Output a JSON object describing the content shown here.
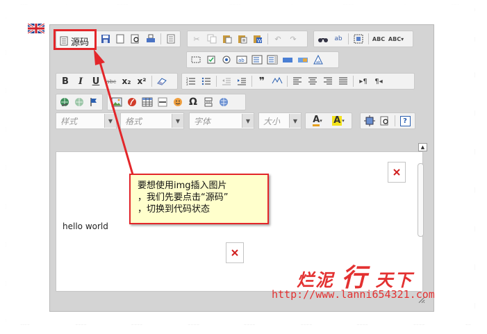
{
  "language": {
    "flag_icon": "uk-flag-icon"
  },
  "toolbar": {
    "source_label": "源码",
    "row1": [
      "save-icon",
      "new-page-icon",
      "preview-icon",
      "print-icon",
      "templates-icon",
      "cut-icon",
      "copy-icon",
      "paste-icon",
      "paste-text-icon",
      "paste-word-icon",
      "undo-icon",
      "redo-icon",
      "find-icon",
      "replace-icon",
      "select-all-icon",
      "spellcheck-icon",
      "spellcheck-as-you-type-icon"
    ],
    "row2": [
      "form-icon",
      "checkbox-icon",
      "radio-icon",
      "textfield-icon",
      "textarea-icon",
      "select-icon",
      "button-icon",
      "image-button-icon",
      "hidden-field-icon"
    ],
    "row3": [
      "bold-icon",
      "italic-icon",
      "underline-icon",
      "strike-icon",
      "subscript-icon",
      "superscript-icon",
      "remove-format-icon",
      "numbered-list-icon",
      "bulleted-list-icon",
      "outdent-icon",
      "indent-icon",
      "blockquote-icon",
      "div-icon",
      "align-left-icon",
      "align-center-icon",
      "align-right-icon",
      "justify-icon",
      "ltr-icon",
      "rtl-icon"
    ],
    "row4": [
      "link-icon",
      "unlink-icon",
      "anchor-icon",
      "image-icon",
      "flash-icon",
      "table-icon",
      "horizontal-rule-icon",
      "smiley-icon",
      "special-char-icon",
      "page-break-icon",
      "iframe-icon"
    ],
    "bold": "B",
    "italic": "I",
    "underline": "U",
    "strike": "abc",
    "subscript": "x₂",
    "superscript": "x²",
    "spell1": "ABC",
    "spell2": "ABC",
    "omega": "Ω",
    "styles_label": "样式",
    "format_label": "格式",
    "font_label": "字体",
    "size_label": "大小",
    "text_color_glyph": "A",
    "bg_color_glyph": "A",
    "help_glyph": "?"
  },
  "content": {
    "text": "hello world"
  },
  "callout": {
    "line1": "要想使用img插入图片",
    "line2": "，我们先要点击“源码”",
    "line3": "，切换到代码状态"
  },
  "watermark": {
    "chars_a": "烂泥",
    "char_big": "行",
    "chars_b": "天下",
    "url": "http://www.lanni654321.com"
  },
  "colors": {
    "highlight": "#e3262a",
    "callout_bg": "#ffffcc",
    "watermark": "#e33131",
    "editor_bg": "#d4d4d4"
  }
}
